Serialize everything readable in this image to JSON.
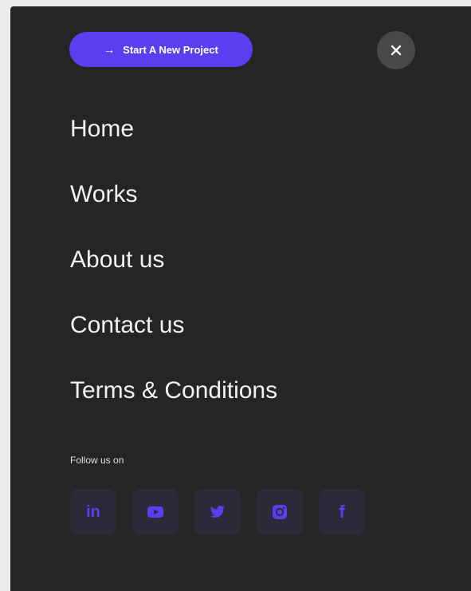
{
  "menu": {
    "cta_label": "Start A New Project",
    "items": [
      {
        "label": "Home"
      },
      {
        "label": "Works"
      },
      {
        "label": "About us"
      },
      {
        "label": "Contact us"
      },
      {
        "label": "Terms & Conditions"
      }
    ],
    "follow_label": "Follow us on",
    "socials": [
      {
        "icon": "linkedin-icon",
        "text": "in"
      },
      {
        "icon": "youtube-icon"
      },
      {
        "icon": "twitter-icon"
      },
      {
        "icon": "instagram-icon"
      },
      {
        "icon": "facebook-icon",
        "text": "f"
      }
    ]
  },
  "colors": {
    "panel": "#252525",
    "accent": "#5a3ef0",
    "social_bg": "#2c2a38",
    "close_bg": "#484848"
  }
}
